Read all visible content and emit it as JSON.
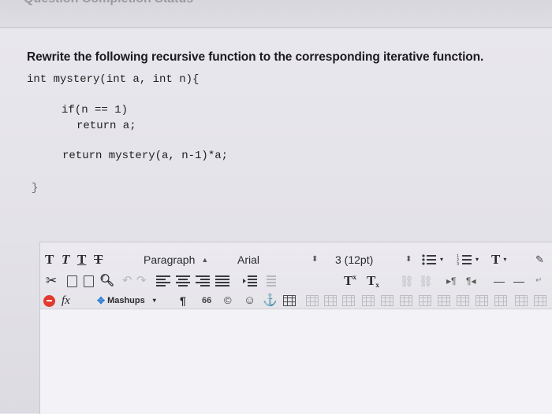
{
  "header": {
    "title": "Question Completion Status"
  },
  "question": {
    "prompt": "Rewrite the following recursive function to the corresponding iterative function."
  },
  "code": {
    "line1": "int mystery(int a, int n){",
    "line2": "if(n == 1)",
    "line3": "return a;",
    "line4": "return mystery(a, n-1)*a;",
    "line5": "}"
  },
  "toolbar": {
    "row1": {
      "format_buttons": [
        "T",
        "T",
        "T",
        "T"
      ],
      "paragraph_select": "Paragraph",
      "font_select": "Arial",
      "size_select": "3 (12pt)"
    },
    "row2": {
      "superscript_label": "T",
      "subscript_label": "T"
    },
    "row3": {
      "fx_label": "fx",
      "mashups_label": "Mashups",
      "quote_label": "66"
    }
  },
  "colors": {
    "accent_red": "#e23a2e",
    "text_dark": "#1b1b1f",
    "disabled": "#b8b7bd"
  }
}
